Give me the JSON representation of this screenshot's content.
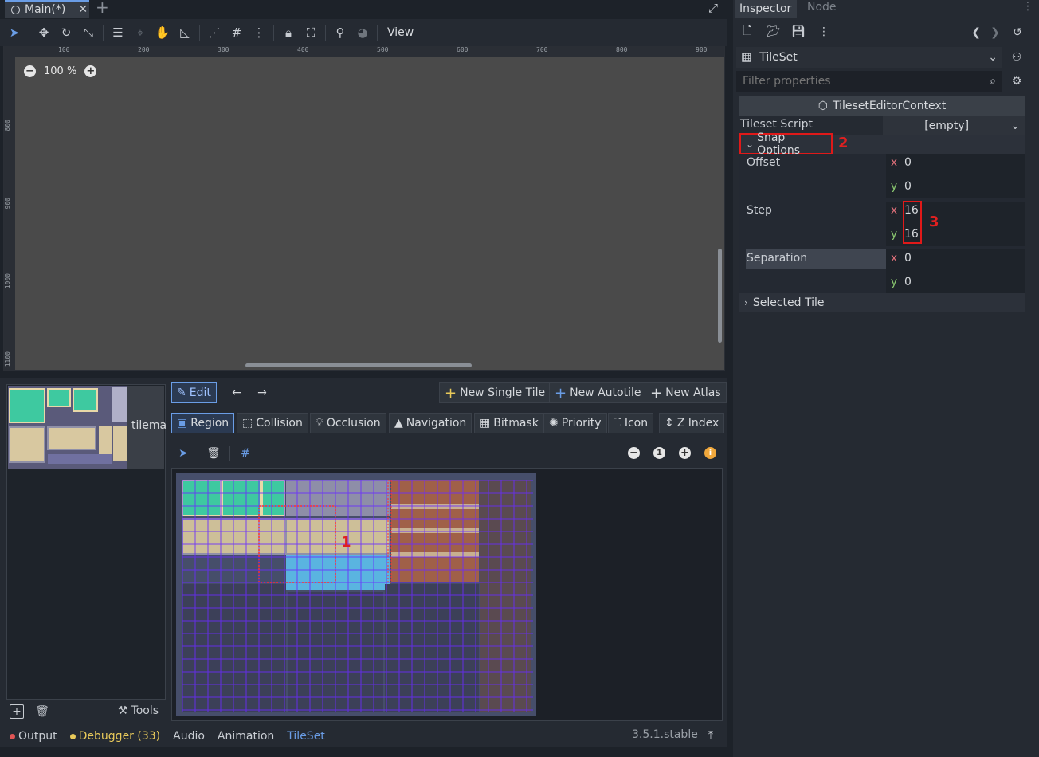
{
  "scene_tab": {
    "title": "Main(*)",
    "close": "✕",
    "add": "+"
  },
  "viewport_toolbar": {
    "view_menu": "View"
  },
  "viewport": {
    "zoom_level": "100 %",
    "ruler_h": [
      "100",
      "200",
      "300",
      "400",
      "500",
      "600",
      "700",
      "800",
      "900"
    ],
    "ruler_v": [
      "800",
      "900",
      "1000",
      "1100"
    ]
  },
  "tileset_editor": {
    "texture_name": "tilema",
    "edit_button": "Edit",
    "new_single_tile": "New Single Tile",
    "new_autotile": "New Autotile",
    "new_atlas": "New Atlas",
    "modes": [
      "Region",
      "Collision",
      "Occlusion",
      "Navigation",
      "Bitmask",
      "Priority",
      "Icon",
      "Z Index"
    ],
    "zoom_reset": "1",
    "annotation": "1",
    "tools_label": "Tools"
  },
  "bottom_bar": {
    "output": "Output",
    "debugger": "Debugger (33)",
    "audio": "Audio",
    "animation": "Animation",
    "tileset": "TileSet",
    "version": "3.5.1.stable"
  },
  "inspector": {
    "tab_inspector": "Inspector",
    "tab_node": "Node",
    "resource_type": "TileSet",
    "filter_placeholder": "Filter properties",
    "context_title": "TilesetEditorContext",
    "tileset_script_label": "Tileset Script",
    "tileset_script_value": "[empty]",
    "snap_options_label": "Snap Options",
    "annotation_2": "2",
    "annotation_3": "3",
    "offset_label": "Offset",
    "offset_x": "0",
    "offset_y": "0",
    "step_label": "Step",
    "step_x": "16",
    "step_y": "16",
    "separation_label": "Separation",
    "separation_x": "0",
    "separation_y": "0",
    "selected_tile_label": "Selected Tile",
    "x_label": "x",
    "y_label": "y"
  },
  "colors": {
    "accent": "#6a9de6",
    "annotation": "#e01919",
    "debugger": "#e8c95a",
    "output_dot": "#e05555"
  }
}
